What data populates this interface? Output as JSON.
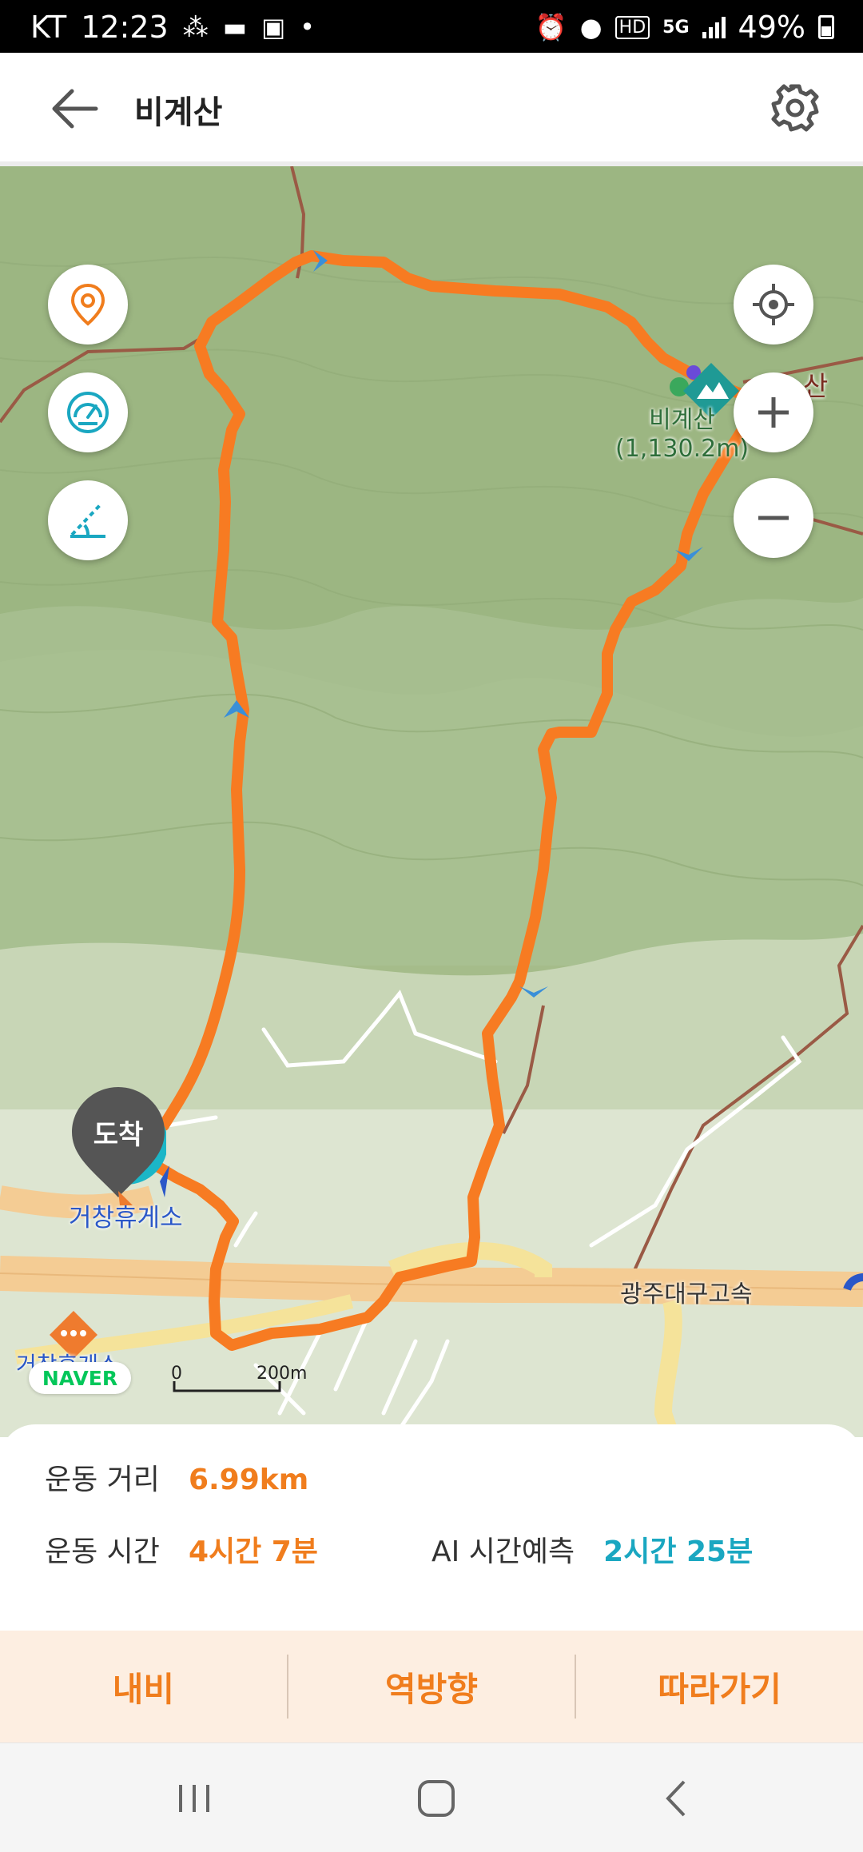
{
  "status_bar": {
    "carrier": "KT",
    "time": "12:23",
    "battery": "49%",
    "network": "5G"
  },
  "header": {
    "title": "비계산"
  },
  "map": {
    "peak_name": "비계산",
    "peak_elevation": "(1,130.2m)",
    "peak_label_right": "산",
    "rest_area": "거창휴게소",
    "rest_area_2": "거창휴게소",
    "highway_name": "광주대구고속",
    "scale_zero": "0",
    "scale_distance": "200m",
    "naver_logo": "NAVER",
    "arrival_label": "도착"
  },
  "stats": {
    "distance_label": "운동 거리",
    "distance_value": "6.99km",
    "time_label": "운동 시간",
    "time_value": "4시간 7분",
    "ai_label": "AI 시간예측",
    "ai_value": "2시간 25분"
  },
  "actions": {
    "navi": "내비",
    "reverse": "역방향",
    "follow": "따라가기"
  },
  "colors": {
    "accent": "#f07d1d",
    "teal": "#1aa7c1",
    "route": "#f77b22"
  }
}
